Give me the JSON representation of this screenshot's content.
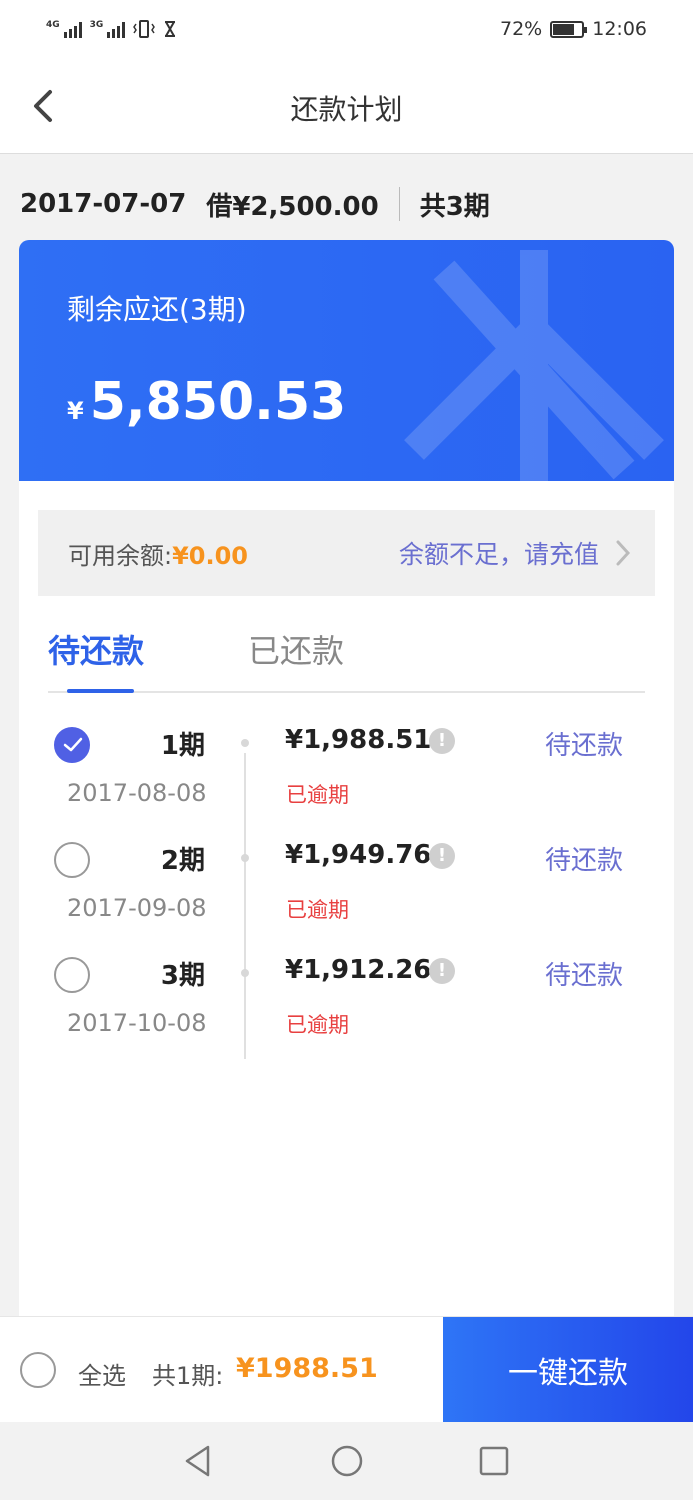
{
  "status_bar": {
    "network1": "4G",
    "network2": "3G",
    "battery_percent": "72%",
    "time": "12:06"
  },
  "header": {
    "title": "还款计划",
    "back_icon": "chevron-left-icon"
  },
  "loan": {
    "date": "2017-07-07",
    "borrowed": "借¥2,500.00",
    "periods": "共3期"
  },
  "balance_card": {
    "label": "剩余应还(3期)",
    "currency": "¥",
    "amount": "5,850.53"
  },
  "available": {
    "label": "可用余额:",
    "amount": "¥0.00",
    "recharge_hint": "余额不足，请充值"
  },
  "tabs": [
    {
      "label": "待还款",
      "active": true
    },
    {
      "label": "已还款",
      "active": false
    }
  ],
  "plans": [
    {
      "period": "1期",
      "date": "2017-08-08",
      "amount": "¥1,988.51",
      "overdue": "已逾期",
      "status": "待还款",
      "checked": true
    },
    {
      "period": "2期",
      "date": "2017-09-08",
      "amount": "¥1,949.76",
      "overdue": "已逾期",
      "status": "待还款",
      "checked": false
    },
    {
      "period": "3期",
      "date": "2017-10-08",
      "amount": "¥1,912.26",
      "overdue": "已逾期",
      "status": "待还款",
      "checked": false
    }
  ],
  "pay_bar": {
    "select_all": "全选",
    "total_label": "共1期:",
    "total_amount": "¥1988.51",
    "pay_button": "一键还款"
  },
  "colors": {
    "primary_blue": "#2f6ff4",
    "accent_orange": "#f7931e",
    "link_purple": "#6a6fd0",
    "overdue_red": "#e84040"
  }
}
